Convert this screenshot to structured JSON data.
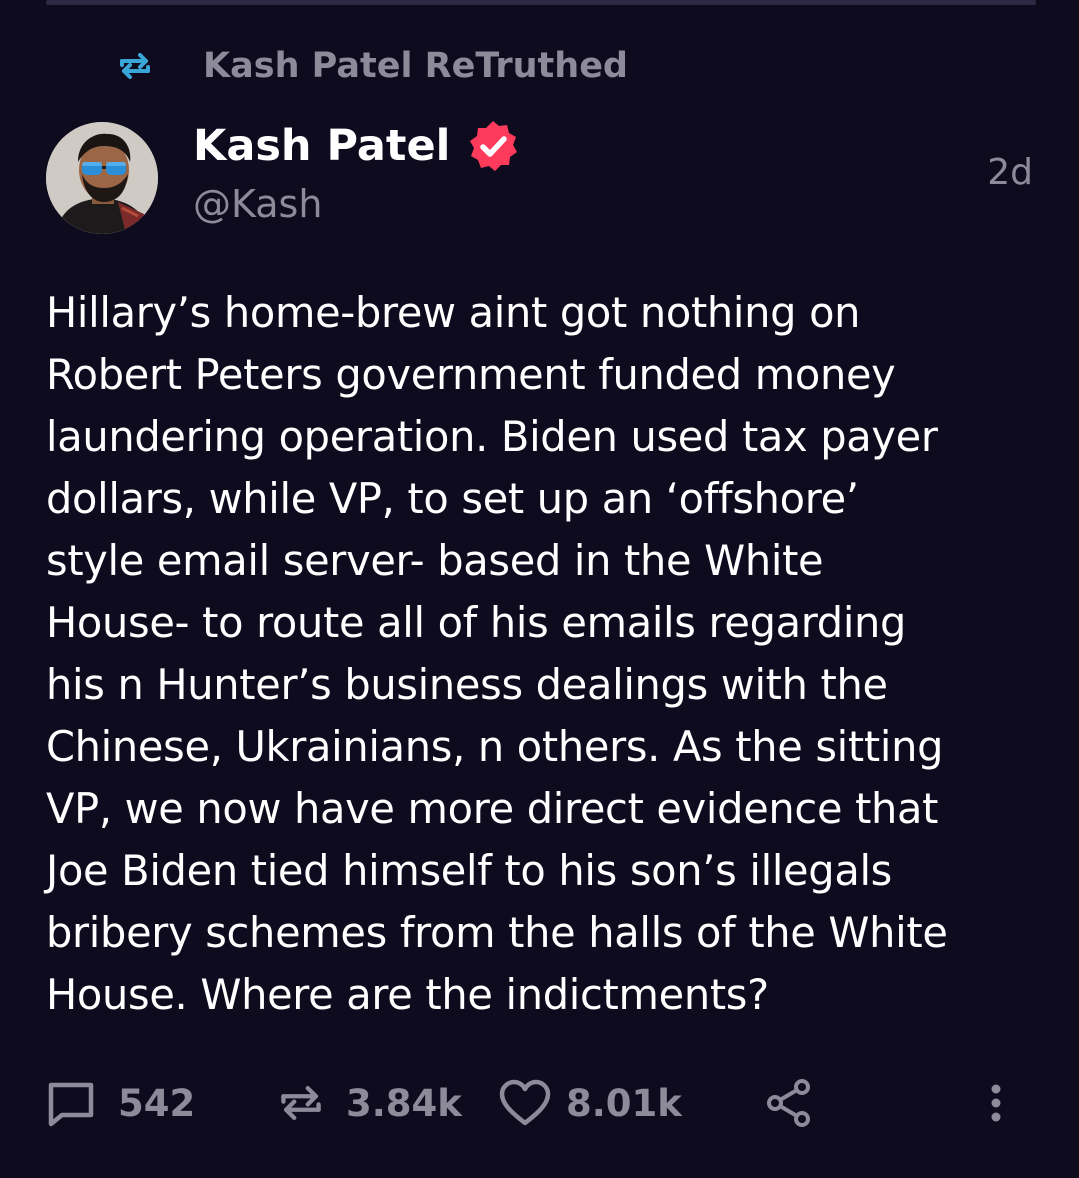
{
  "retruth_banner": {
    "label": "Kash Patel ReTruthed",
    "icon": "retruth-icon",
    "accent_color": "#3aa6d8"
  },
  "author": {
    "name": "Kash Patel",
    "handle": "@Kash",
    "verified_icon": "verified-badge-icon",
    "verified_color": "#ff3b5c",
    "avatar": "avatar"
  },
  "timestamp": "2d",
  "body": "Hillary’s home-brew aint got nothing on\nRobert Peters government funded money\nlaundering operation. Biden used tax payer\ndollars, while VP, to set up an ‘offshore’\nstyle email server- based in the White\nHouse- to route all of his emails regarding\nhis n Hunter’s business dealings with the\nChinese, Ukrainians, n others. As the sitting\nVP, we now have more direct evidence that\nJoe Biden tied himself to his son’s illegals\nbribery schemes from the halls of the White\nHouse. Where are the indictments?",
  "actions": {
    "reply": {
      "icon": "comment-icon",
      "count": "542"
    },
    "retruth": {
      "icon": "retruth-icon",
      "count": "3.84k"
    },
    "like": {
      "icon": "heart-icon",
      "count": "8.01k"
    },
    "share": {
      "icon": "share-icon"
    },
    "more": {
      "icon": "more-vertical-icon"
    }
  },
  "colors": {
    "background": "#0e0b1f",
    "text_primary": "#ffffff",
    "text_secondary": "#8d8b99"
  }
}
